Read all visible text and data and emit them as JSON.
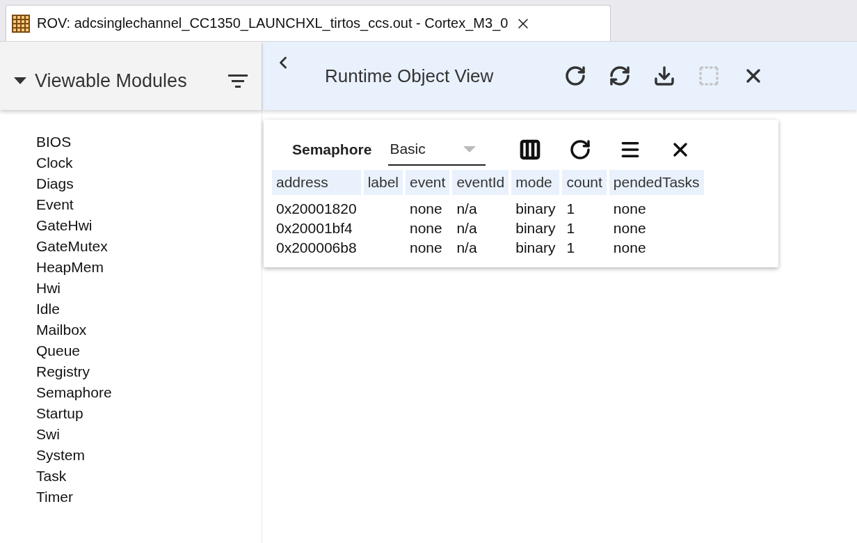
{
  "editor_tab": {
    "title": "ROV: adcsinglechannel_CC1350_LAUNCHXL_tirtos_ccs.out - Cortex_M3_0",
    "selected": true
  },
  "sidebar": {
    "title": "Viewable Modules",
    "expanded": true,
    "items": [
      {
        "label": "BIOS"
      },
      {
        "label": "Clock"
      },
      {
        "label": "Diags"
      },
      {
        "label": "Event"
      },
      {
        "label": "GateHwi"
      },
      {
        "label": "GateMutex"
      },
      {
        "label": "HeapMem"
      },
      {
        "label": "Hwi"
      },
      {
        "label": "Idle"
      },
      {
        "label": "Mailbox"
      },
      {
        "label": "Queue"
      },
      {
        "label": "Registry"
      },
      {
        "label": "Semaphore"
      },
      {
        "label": "Startup"
      },
      {
        "label": "Swi"
      },
      {
        "label": "System"
      },
      {
        "label": "Task"
      },
      {
        "label": "Timer"
      }
    ]
  },
  "header": {
    "title": "Runtime Object View",
    "toolbar": [
      {
        "kind": "refresh",
        "disabled": false
      },
      {
        "kind": "sync",
        "disabled": false
      },
      {
        "kind": "download",
        "disabled": false
      },
      {
        "kind": "select",
        "disabled": true
      },
      {
        "kind": "close",
        "disabled": false
      }
    ]
  },
  "panel": {
    "module": "Semaphore",
    "view": "Basic",
    "toolbar": [
      {
        "kind": "columns"
      },
      {
        "kind": "refresh"
      },
      {
        "kind": "menu"
      },
      {
        "kind": "close"
      }
    ],
    "table": {
      "columns": [
        "address",
        "label",
        "event",
        "eventId",
        "mode",
        "count",
        "pendedTasks"
      ],
      "rows": [
        [
          "0x20001820",
          "",
          "none",
          "n/a",
          "binary",
          "1",
          "none"
        ],
        [
          "0x20001bf4",
          "",
          "none",
          "n/a",
          "binary",
          "1",
          "none"
        ],
        [
          "0x200006b8",
          "",
          "none",
          "n/a",
          "binary",
          "1",
          "none"
        ]
      ]
    }
  }
}
